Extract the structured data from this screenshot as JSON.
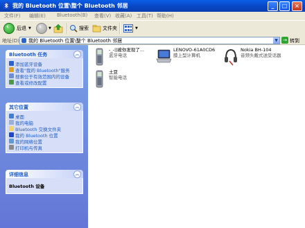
{
  "window": {
    "title": "我的 Bluetooth 位置\\整个 Bluetooth 邻居",
    "minimize": "_",
    "maximize": "□",
    "close": "×"
  },
  "menu": [
    "文件(F)",
    "编辑(E)",
    "Bluetooth(B)",
    "查看(V)",
    "收藏(A)",
    "工具(T)",
    "帮助(H)"
  ],
  "toolbar": {
    "back_label": "后退",
    "search_label": "搜索",
    "folders_label": "文件夹"
  },
  "address": {
    "label": "地址(D)",
    "value": "我的 Bluetooth 位置\\整个 Bluetooth 邻居",
    "go_label": "转到"
  },
  "bluetooth_tasks": {
    "title": "Bluetooth 任务",
    "items": [
      "添加蓝牙设备",
      "查看\"我的 Bluetooth\"服务",
      "搜索位于有效范围内的设备",
      "查看或修改配置"
    ]
  },
  "other_places": {
    "title": "其它位置",
    "items": [
      "桌面",
      "我的电脑",
      "Bluetooth 交换文件夹",
      "我的 Bluetooth 位置",
      "我的网络位置",
      "打印机与传真"
    ]
  },
  "details": {
    "title": "详细信息",
    "text": "Bluetooth 设备"
  },
  "devices": [
    {
      "name": "-_-||被你发现了...",
      "type": "蓝牙电话",
      "icon": "phone-icon"
    },
    {
      "name": "LENOVO-61A0CD6",
      "type": "膝上型计算机",
      "icon": "laptop-icon"
    },
    {
      "name": "Nokia BH-104",
      "type": "音频头戴式送受话器",
      "icon": "headset-icon"
    },
    {
      "name": "土豆",
      "type": "智能电话",
      "icon": "phone-icon"
    }
  ],
  "colors": {
    "titlebar": "#0a5fe8",
    "leftpane": "#7ba2e7",
    "link": "#215dc6"
  }
}
